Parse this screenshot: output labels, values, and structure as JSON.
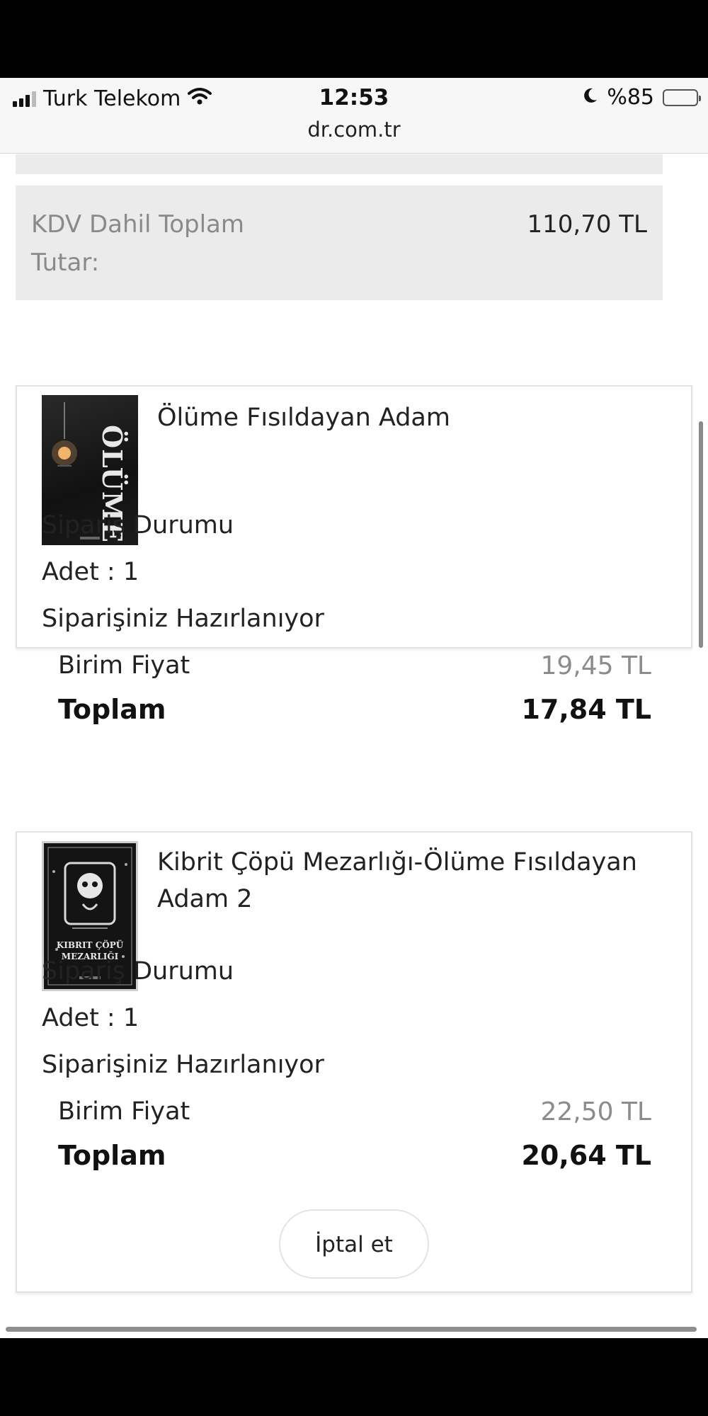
{
  "status_bar": {
    "carrier": "Turk Telekom",
    "time": "12:53",
    "battery": "%85",
    "battery_level": 0.85,
    "icons": [
      "signal-icon",
      "wifi-icon",
      "moon-icon",
      "battery-icon"
    ]
  },
  "browser": {
    "url": "dr.com.tr"
  },
  "summary": {
    "total_label": "KDV Dahil Toplam Tutar:",
    "total_value": "110,70 TL"
  },
  "orders": [
    {
      "title": "Ölüme Fısıldayan Adam",
      "cover_text": "ÖLÜME",
      "status_heading": "Sipariş Durumu",
      "quantity": "Adet : 1",
      "status": "Siparişiniz Hazırlanıyor",
      "unit_price_label": "Birim Fiyat",
      "unit_price": "19,45 TL",
      "total_label": "Toplam",
      "total": "17,84 TL"
    },
    {
      "title": "Kibrit Çöpü Mezarlığı-Ölüme Fısıldayan Adam 2",
      "cover_text": "KIBRIT ÇÖPÜ MEZARLIĞI",
      "status_heading": "Sipariş Durumu",
      "quantity": "Adet : 1",
      "status": "Siparişiniz Hazırlanıyor",
      "unit_price_label": "Birim Fiyat",
      "unit_price": "22,50 TL",
      "total_label": "Toplam",
      "total": "20,64 TL",
      "cancel_label": "İptal et"
    }
  ],
  "colors": {
    "summary_bg": "#ebebeb",
    "muted_text": "#8a8a8a",
    "battery": "#f5c400"
  }
}
